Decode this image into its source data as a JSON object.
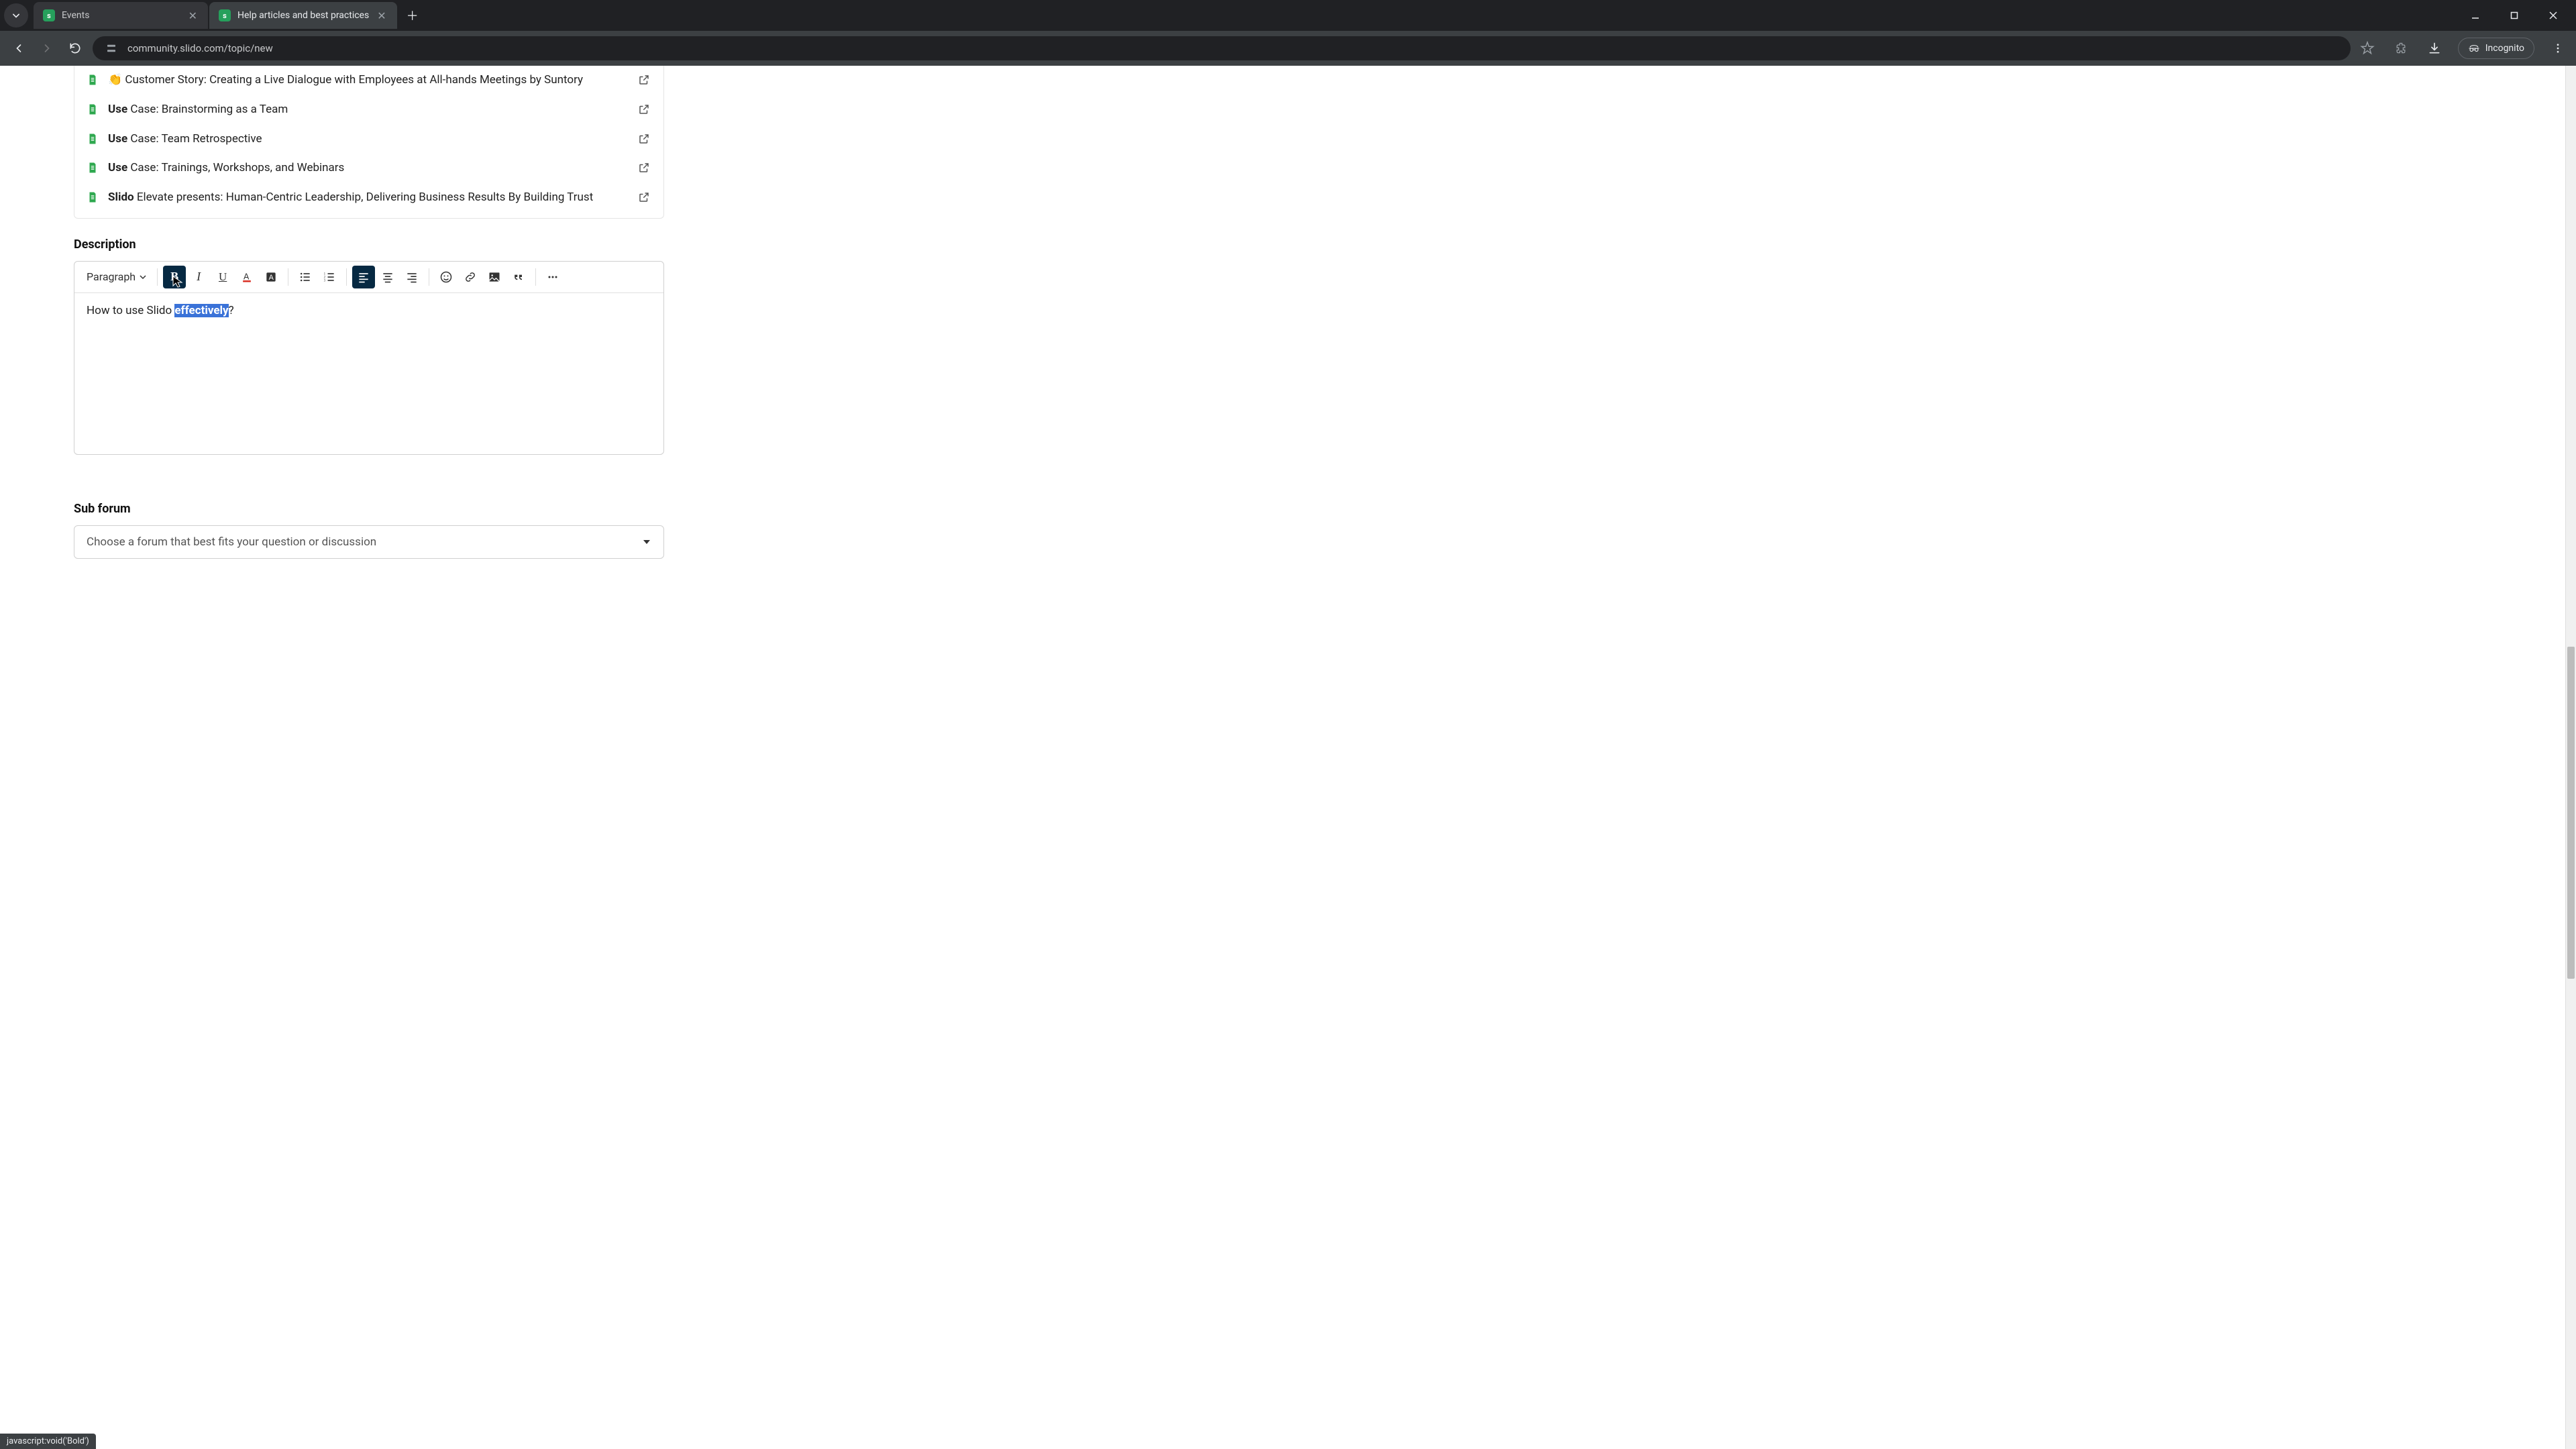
{
  "browser": {
    "tabs": [
      {
        "title": "Events"
      },
      {
        "title": "Help articles and best practices"
      }
    ],
    "url": "community.slido.com/topic/new",
    "incognito_label": "Incognito"
  },
  "topics": [
    {
      "emoji": "👏",
      "bold": "",
      "rest": "Customer Story: Creating a Live Dialogue with Employees at All-hands Meetings by Suntory"
    },
    {
      "emoji": "",
      "bold": "Use",
      "rest": " Case: Brainstorming as a Team"
    },
    {
      "emoji": "",
      "bold": "Use",
      "rest": " Case: Team Retrospective"
    },
    {
      "emoji": "",
      "bold": "Use",
      "rest": " Case: Trainings, Workshops, and Webinars"
    },
    {
      "emoji": "",
      "bold": "Slido",
      "rest": " Elevate presents: Human-Centric Leadership, Delivering Business Results By Building Trust"
    }
  ],
  "labels": {
    "description": "Description",
    "paragraph": "Paragraph",
    "subforum": "Sub forum",
    "subforum_placeholder": "Choose a forum that best fits your question or discussion"
  },
  "editor": {
    "before": "How to use Slido ",
    "selected": "effectively",
    "after": "?"
  },
  "status_bar": "javascript:void('Bold')"
}
